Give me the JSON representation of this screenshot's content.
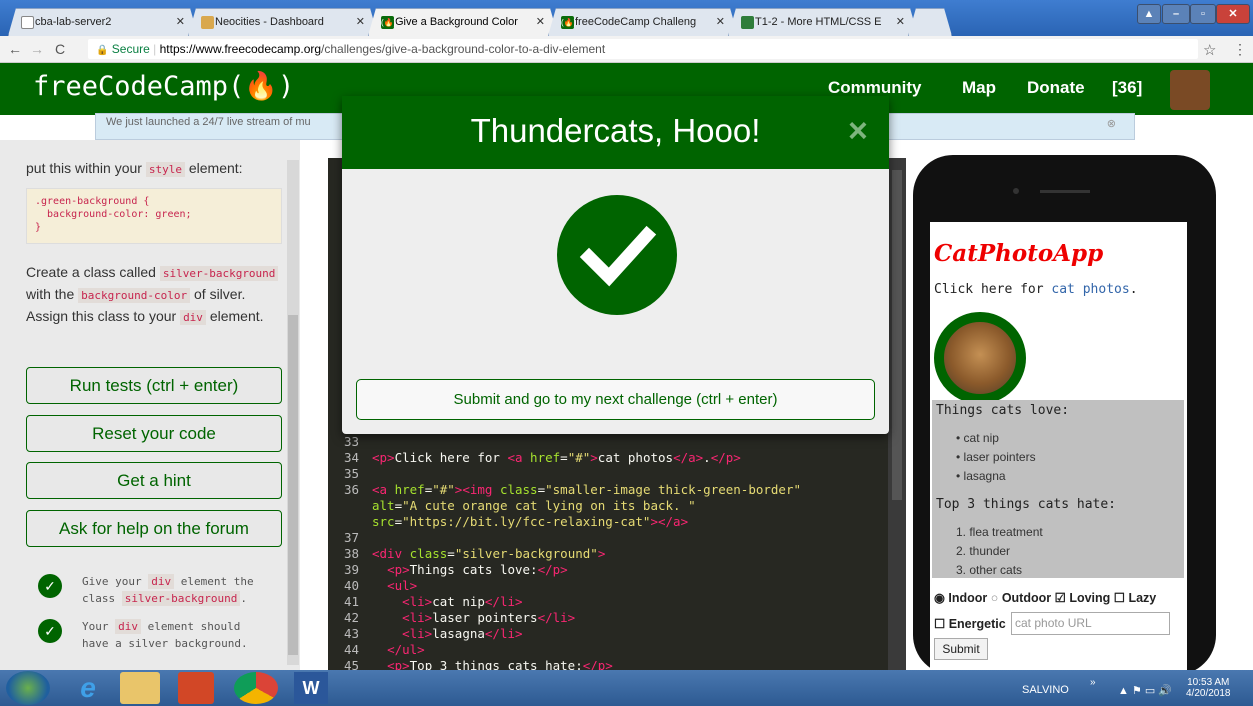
{
  "browser": {
    "tabs": [
      {
        "label": "cba-lab-server2",
        "active": false
      },
      {
        "label": "Neocities - Dashboard",
        "active": false
      },
      {
        "label": "Give a Background Color",
        "active": true
      },
      {
        "label": "freeCodeCamp Challeng",
        "active": false
      },
      {
        "label": "T1-2 - More HTML/CSS E",
        "active": false
      }
    ],
    "secure_label": "Secure",
    "url_domain": "https://www.freecodecamp.org",
    "url_path": "/challenges/give-a-background-color-to-a-div-element"
  },
  "fcc_nav": {
    "logo": "freeCodeCamp(🔥)",
    "links": [
      "Community",
      "Map",
      "Donate",
      "[36]"
    ]
  },
  "announcement": "We just launched a 24/7 live stream of mu",
  "instructions": {
    "intro_text": "put this within your",
    "intro_code": "style",
    "intro_tail": "element:",
    "code_block": [
      ".green-background {",
      "  background-color: green;",
      "}"
    ],
    "task_p1": "Create a class called",
    "task_c1": "silver-background",
    "task_p2": "with the",
    "task_c2": "background-color",
    "task_p3": "of silver. Assign this class to your",
    "task_c3": "div",
    "task_p4": "element."
  },
  "buttons": {
    "run": "Run tests (ctrl + enter)",
    "reset": "Reset your code",
    "hint": "Get a hint",
    "help": "Ask for help on the forum"
  },
  "tests": [
    {
      "pre": "Give your",
      "code": "div",
      "mid": "element the class",
      "code2": "silver-background",
      "post": "."
    },
    {
      "pre": "Your",
      "code": "div",
      "mid": "element should have a silver background.",
      "code2": "",
      "post": ""
    }
  ],
  "editor": {
    "line_numbers": [
      "33",
      "34",
      "35",
      "36",
      "",
      "",
      "37",
      "38",
      "39",
      "40",
      "41",
      "42",
      "43",
      "44",
      "45"
    ]
  },
  "preview": {
    "title": "CatPhotoApp",
    "click_text": "Click here for",
    "click_link": "cat photos",
    "click_end": ".",
    "loves_heading": "Things cats love:",
    "loves": [
      "cat nip",
      "laser pointers",
      "lasagna"
    ],
    "hates_heading": "Top 3 things cats hate:",
    "hates": [
      "1. flea treatment",
      "2. thunder",
      "3. other cats"
    ],
    "radio_indoor": "Indoor",
    "radio_outdoor": "Outdoor",
    "check_loving": "Loving",
    "check_lazy": "Lazy",
    "check_energetic": "Energetic",
    "url_placeholder": "cat photo URL",
    "submit": "Submit"
  },
  "modal": {
    "title": "Thundercats, Hooo!",
    "close": "×",
    "submit_next": "Submit and go to my next challenge (ctrl + enter)"
  },
  "taskbar": {
    "user": "SALVINO",
    "time": "10:53 AM",
    "date": "4/20/2018"
  },
  "colors": {
    "fcc_green": "#006400",
    "editor_bg": "#272822"
  }
}
